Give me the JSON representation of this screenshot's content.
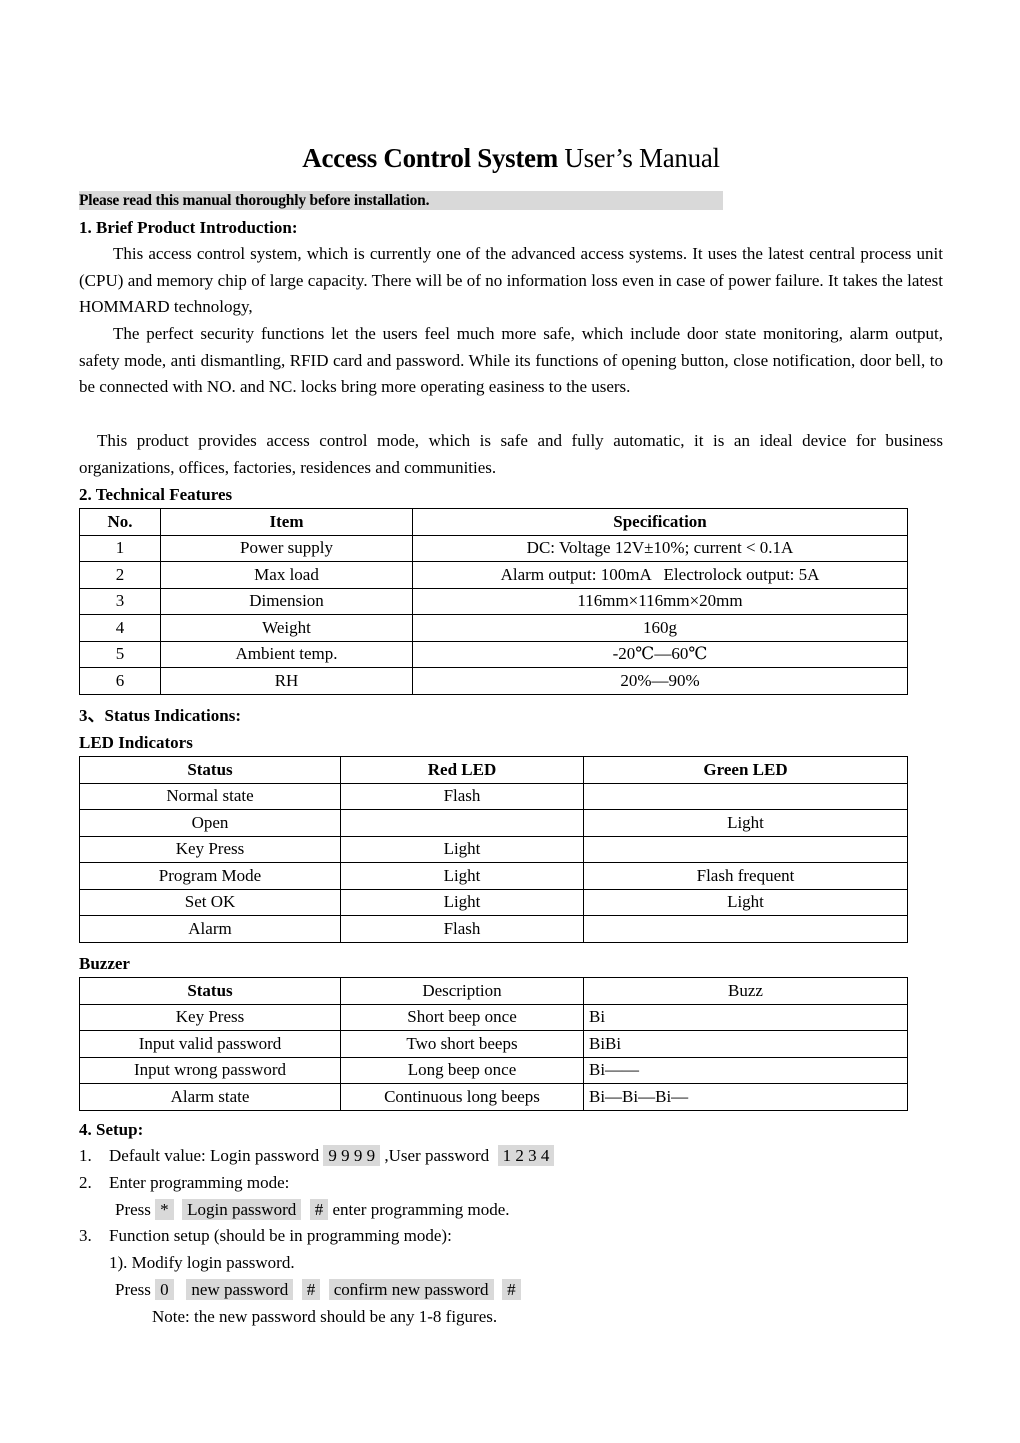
{
  "title": {
    "bold": "Access Control System",
    "normal": " User’s Manual"
  },
  "notice": "Please read this manual thoroughly before installation.",
  "section1": {
    "heading": "1. Brief Product Introduction:",
    "p1": "This access control system, which is currently one of the advanced  access systems. It uses the latest central process unit (CPU) and memory chip of large capacity. There will be of no information loss even in case of power failure. It takes the latest HOMMARD technology,",
    "p2": "The perfect security functions let the users feel much more safe, which include door state monitoring, alarm output, safety mode, anti dismantling, RFID card and password. While its functions of opening button, close notification, door bell, to be connected with NO. and NC. locks bring more operating easiness to the users.",
    "p3": "This product provides access control mode, which is safe and fully automatic, it is an ideal device for business organizations, offices, factories, residences and communities."
  },
  "section2": {
    "heading": "2. Technical Features",
    "headers": [
      "No.",
      "Item",
      "Specification"
    ],
    "rows": [
      [
        "1",
        "Power supply",
        "DC: Voltage 12V±10%; current < 0.1A"
      ],
      [
        "2",
        "Max load",
        "Alarm output: 100mA   Electrolock output: 5A"
      ],
      [
        "3",
        "Dimension",
        "116mm×116mm×20mm"
      ],
      [
        "4",
        "Weight",
        "160g"
      ],
      [
        "5",
        "Ambient temp.",
        "-20℃—60℃"
      ],
      [
        "6",
        "RH",
        "20%—90%"
      ]
    ]
  },
  "section3": {
    "heading": "3、Status Indications:",
    "led": {
      "heading": "LED Indicators",
      "headers": [
        "Status",
        "Red LED",
        "Green LED"
      ],
      "rows": [
        [
          "Normal state",
          "Flash",
          ""
        ],
        [
          "Open",
          "",
          "Light"
        ],
        [
          "Key Press",
          "Light",
          ""
        ],
        [
          "Program Mode",
          "Light",
          "Flash frequent"
        ],
        [
          "Set OK",
          "Light",
          "Light"
        ],
        [
          "Alarm",
          "Flash",
          ""
        ]
      ]
    },
    "buzzer": {
      "heading": "Buzzer",
      "headers": [
        "Status",
        "Description",
        "Buzz"
      ],
      "rows": [
        [
          "Key Press",
          "Short beep once",
          "Bi"
        ],
        [
          "Input valid password",
          "Two short beeps",
          "BiBi"
        ],
        [
          "Input wrong password",
          "Long beep once",
          "Bi——"
        ],
        [
          "Alarm state",
          "Continuous long beeps",
          "Bi—Bi—Bi—"
        ]
      ]
    }
  },
  "section4": {
    "heading": "4. Setup:",
    "item1": {
      "num": "1.",
      "text": "Default value: Login password ",
      "key1": "9 9 9 9",
      "mid": " ,User password ",
      "key2": "1 2 3 4"
    },
    "item2": {
      "num": "2.",
      "text": "Enter programming mode:"
    },
    "item2_press": {
      "press": "Press ",
      "k1": "*",
      "k2": "Login password",
      "k3": "#",
      "tail": " enter programming mode."
    },
    "item3": {
      "num": "3.",
      "text": "Function setup (should be in programming mode):"
    },
    "sub1": "1). Modify login password.",
    "sub1_press": {
      "press": "Press ",
      "k1": "0",
      "k2": "new password",
      "k3": "#",
      "k4": "confirm new password",
      "k5": "#"
    },
    "note": "Note: the new password should be any 1-8 figures."
  }
}
